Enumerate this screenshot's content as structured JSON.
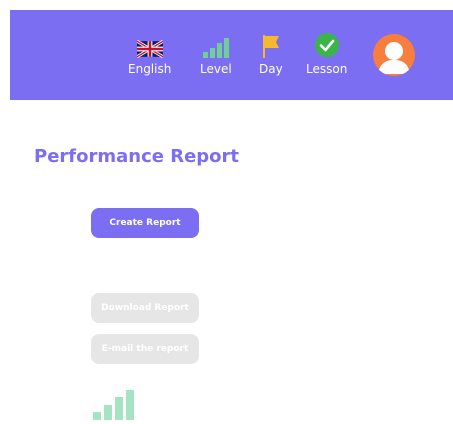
{
  "header": {
    "nav": [
      {
        "id": "language",
        "label": "English",
        "icon": "uk-flag-icon"
      },
      {
        "id": "level",
        "label": "Level",
        "icon": "signal-bars-icon"
      },
      {
        "id": "day",
        "label": "Day",
        "icon": "flag-icon"
      },
      {
        "id": "lesson",
        "label": "Lesson",
        "icon": "check-circle-icon"
      }
    ],
    "avatar_icon": "user-avatar-icon"
  },
  "main": {
    "title": "Performance Report",
    "create_button": "Create Report",
    "download_button": "Download Report",
    "email_button": "E-mail the report",
    "level_icon": "signal-bars-icon"
  },
  "colors": {
    "primary": "#7c6ef2",
    "avatar": "#f77e3d",
    "level_bars": "#6fcf97",
    "day_flag": "#f5b82e",
    "lesson_check": "#3bb54a",
    "disabled": "#e6e6e6"
  }
}
